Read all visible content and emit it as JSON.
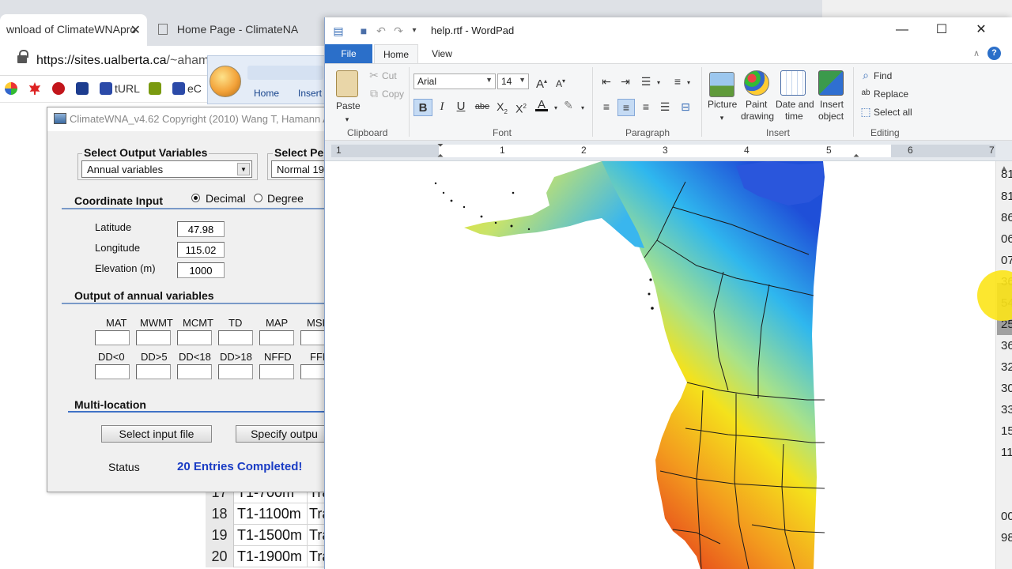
{
  "browser": {
    "tabs": [
      {
        "label": "wnload of ClimateWNApro"
      },
      {
        "label": "Home Page - ClimateNA"
      }
    ],
    "url_host": "https://sites.ualberta.ca",
    "url_path": "/~ahama",
    "bookmarks": [
      "tURL",
      "eC"
    ]
  },
  "office_ribbon": {
    "tabs": [
      "Home",
      "Insert"
    ]
  },
  "sheet": {
    "rows": [
      {
        "num": "17",
        "name": "T1-700m",
        "trail": "Tra"
      },
      {
        "num": "18",
        "name": "T1-1100m",
        "trail": "Tra"
      },
      {
        "num": "19",
        "name": "T1-1500m",
        "trail": "Tra"
      },
      {
        "num": "20",
        "name": "T1-1900m",
        "trail": "Tra"
      }
    ]
  },
  "climate": {
    "title": "ClimateWNA_v4.62  Copyright (2010) Wang T, Hamann A",
    "select_output_label": "Select Output Variables",
    "select_output_value": "Annual variables",
    "select_period_label": "Select Pe",
    "select_period_value": "Normal 19",
    "coord_label": "Coordinate Input",
    "radio_decimal": "Decimal",
    "radio_degree": "Degree",
    "latitude_label": "Latitude",
    "latitude_value": "47.98",
    "longitude_label": "Longitude",
    "longitude_value": "115.02",
    "elevation_label": "Elevation (m)",
    "elevation_value": "1000",
    "output_label": "Output of annual variables",
    "vars_row1": [
      "MAT",
      "MWMT",
      "MCMT",
      "TD",
      "MAP",
      "MSI"
    ],
    "vars_row2": [
      "DD<0",
      "DD>5",
      "DD<18",
      "DD>18",
      "NFFD",
      "FFI"
    ],
    "multi_label": "Multi-location",
    "select_input_button": "Select input file",
    "specify_output_button": "Specify outpu",
    "status_label": "Status",
    "status_value": "20 Entries Completed!"
  },
  "wordpad": {
    "title": "help.rtf - WordPad",
    "tabs": {
      "file": "File",
      "home": "Home",
      "view": "View"
    },
    "clipboard": {
      "paste": "Paste",
      "cut": "Cut",
      "copy": "Copy",
      "group": "Clipboard"
    },
    "font": {
      "name": "Arial",
      "size": "14",
      "group": "Font"
    },
    "paragraph": {
      "group": "Paragraph"
    },
    "insert": {
      "picture": "Picture",
      "paint_1": "Paint",
      "paint_2": "drawing",
      "datetime_1": "Date and",
      "datetime_2": "time",
      "object_1": "Insert",
      "object_2": "object",
      "group": "Insert"
    },
    "editing": {
      "find": "Find",
      "replace": "Replace",
      "select_all": "Select all",
      "group": "Editing"
    },
    "ruler": [
      "1",
      "1",
      "2",
      "3",
      "4",
      "5",
      "6",
      "7"
    ]
  },
  "edge_numbers": [
    "81",
    "81",
    "86",
    "06",
    "07",
    "36",
    "54",
    "25",
    "36",
    "32",
    "30",
    "33",
    "15",
    "11",
    "00",
    "98"
  ],
  "colors": {
    "accent": "#2b6fc9",
    "status_text": "#1a3cc4",
    "map_cold": "#1f4fd8",
    "map_mid": "#f4e21c",
    "map_hot": "#e3331b"
  }
}
